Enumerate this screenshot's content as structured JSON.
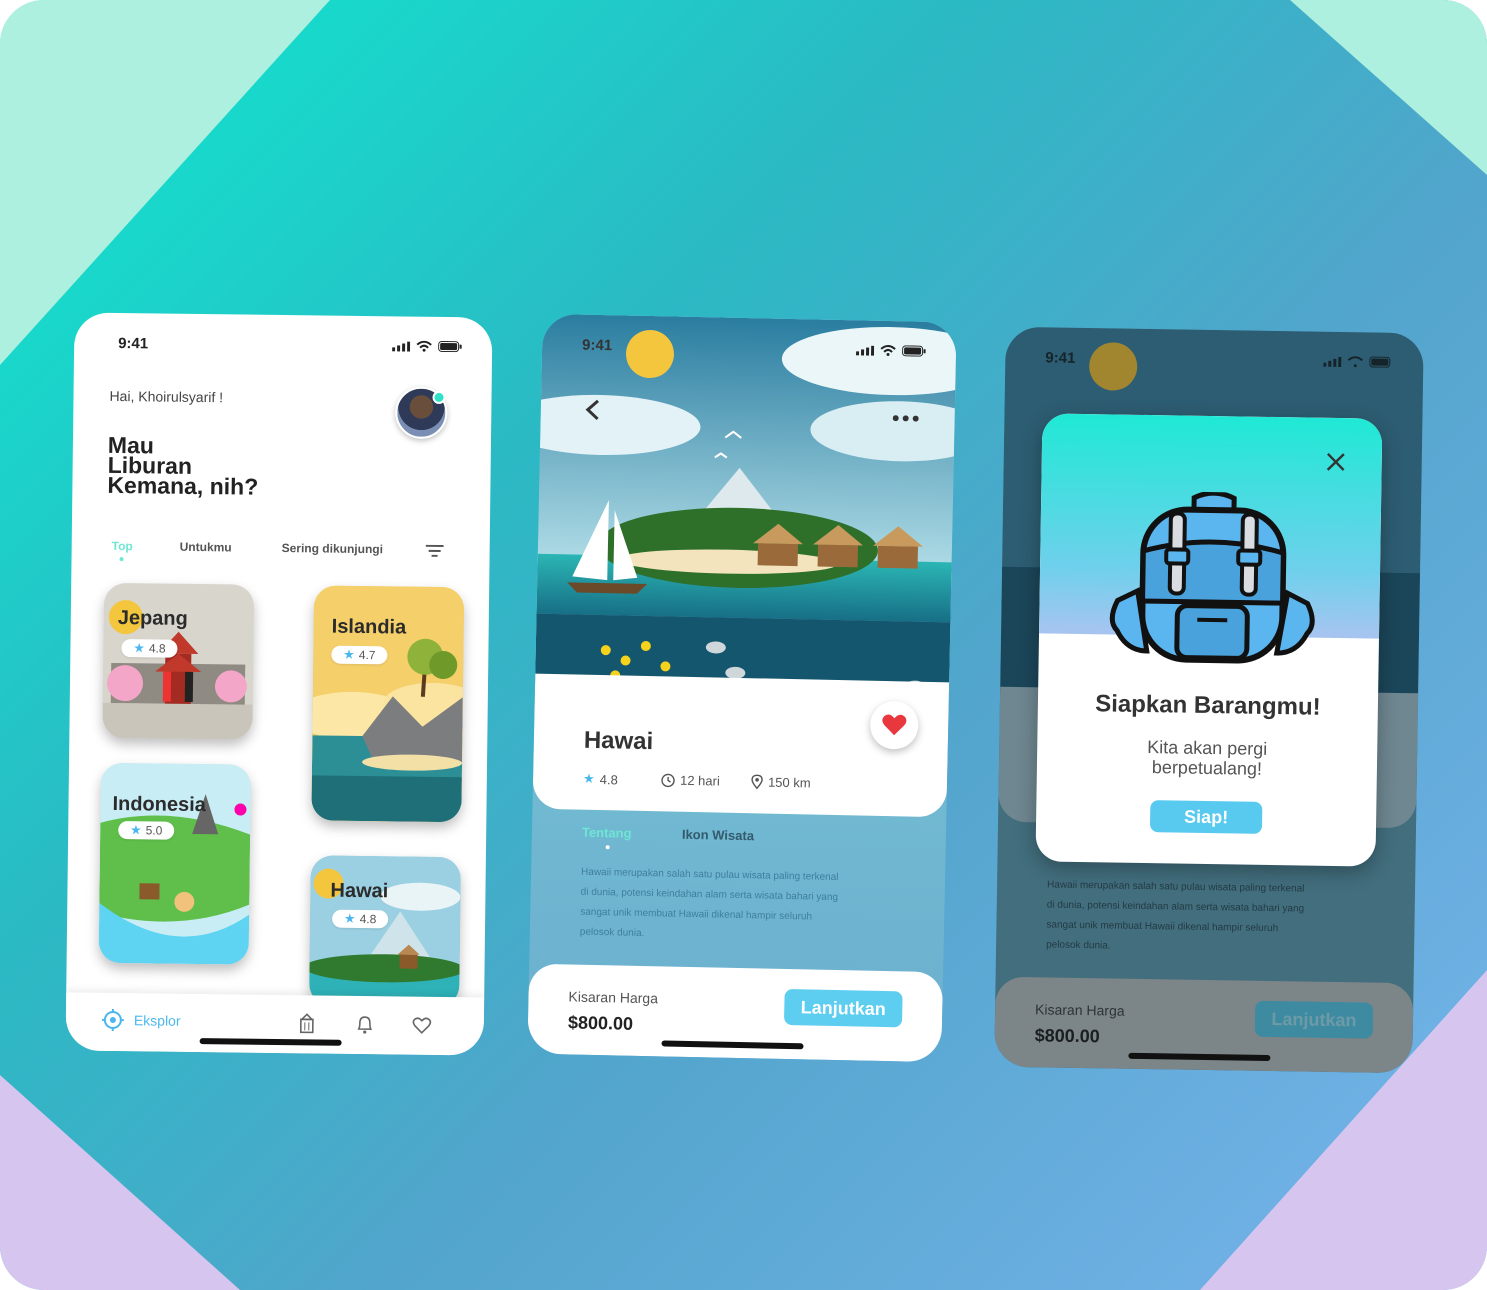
{
  "colors": {
    "accent": "#6fe6d4",
    "button": "#5dcdf0",
    "heart": "#e8383d",
    "star": "#4ab8ef"
  },
  "status_bar": {
    "time": "9:41"
  },
  "home": {
    "greeting": "Hai, Khoirulsyarif !",
    "headline": [
      "Mau",
      "Liburan",
      "Kemana, nih?"
    ],
    "tabs": [
      "Top",
      "Untukmu",
      "Sering dikunjungi"
    ],
    "active_tab": "Top",
    "destinations": [
      {
        "name": "Jepang",
        "rating": "4.8"
      },
      {
        "name": "Islandia",
        "rating": "4.7"
      },
      {
        "name": "Indonesia",
        "rating": "5.0"
      },
      {
        "name": "Hawai",
        "rating": "4.8"
      }
    ],
    "nav": {
      "explore_label": "Eksplor",
      "icons": [
        "compass-icon",
        "building-icon",
        "bell-icon",
        "heart-icon"
      ]
    }
  },
  "detail": {
    "title": "Hawai",
    "rating": "4.8",
    "duration": "12 hari",
    "distance": "150 km",
    "tabs": [
      "Tentang",
      "Ikon Wisata"
    ],
    "description": "Hawaii merupakan salah satu pulau wisata paling terkenal di dunia, potensi keindahan alam serta wisata bahari yang sangat unik membuat Hawaii dikenal hampir seluruh pelosok dunia.",
    "price_label": "Kisaran Harga",
    "price": "$800.00",
    "cta": "Lanjutkan"
  },
  "modal": {
    "title": "Siapkan Barangmu!",
    "subtitle_line1": "Kita akan pergi",
    "subtitle_line2": "berpetualang!",
    "button": "Siap!"
  }
}
